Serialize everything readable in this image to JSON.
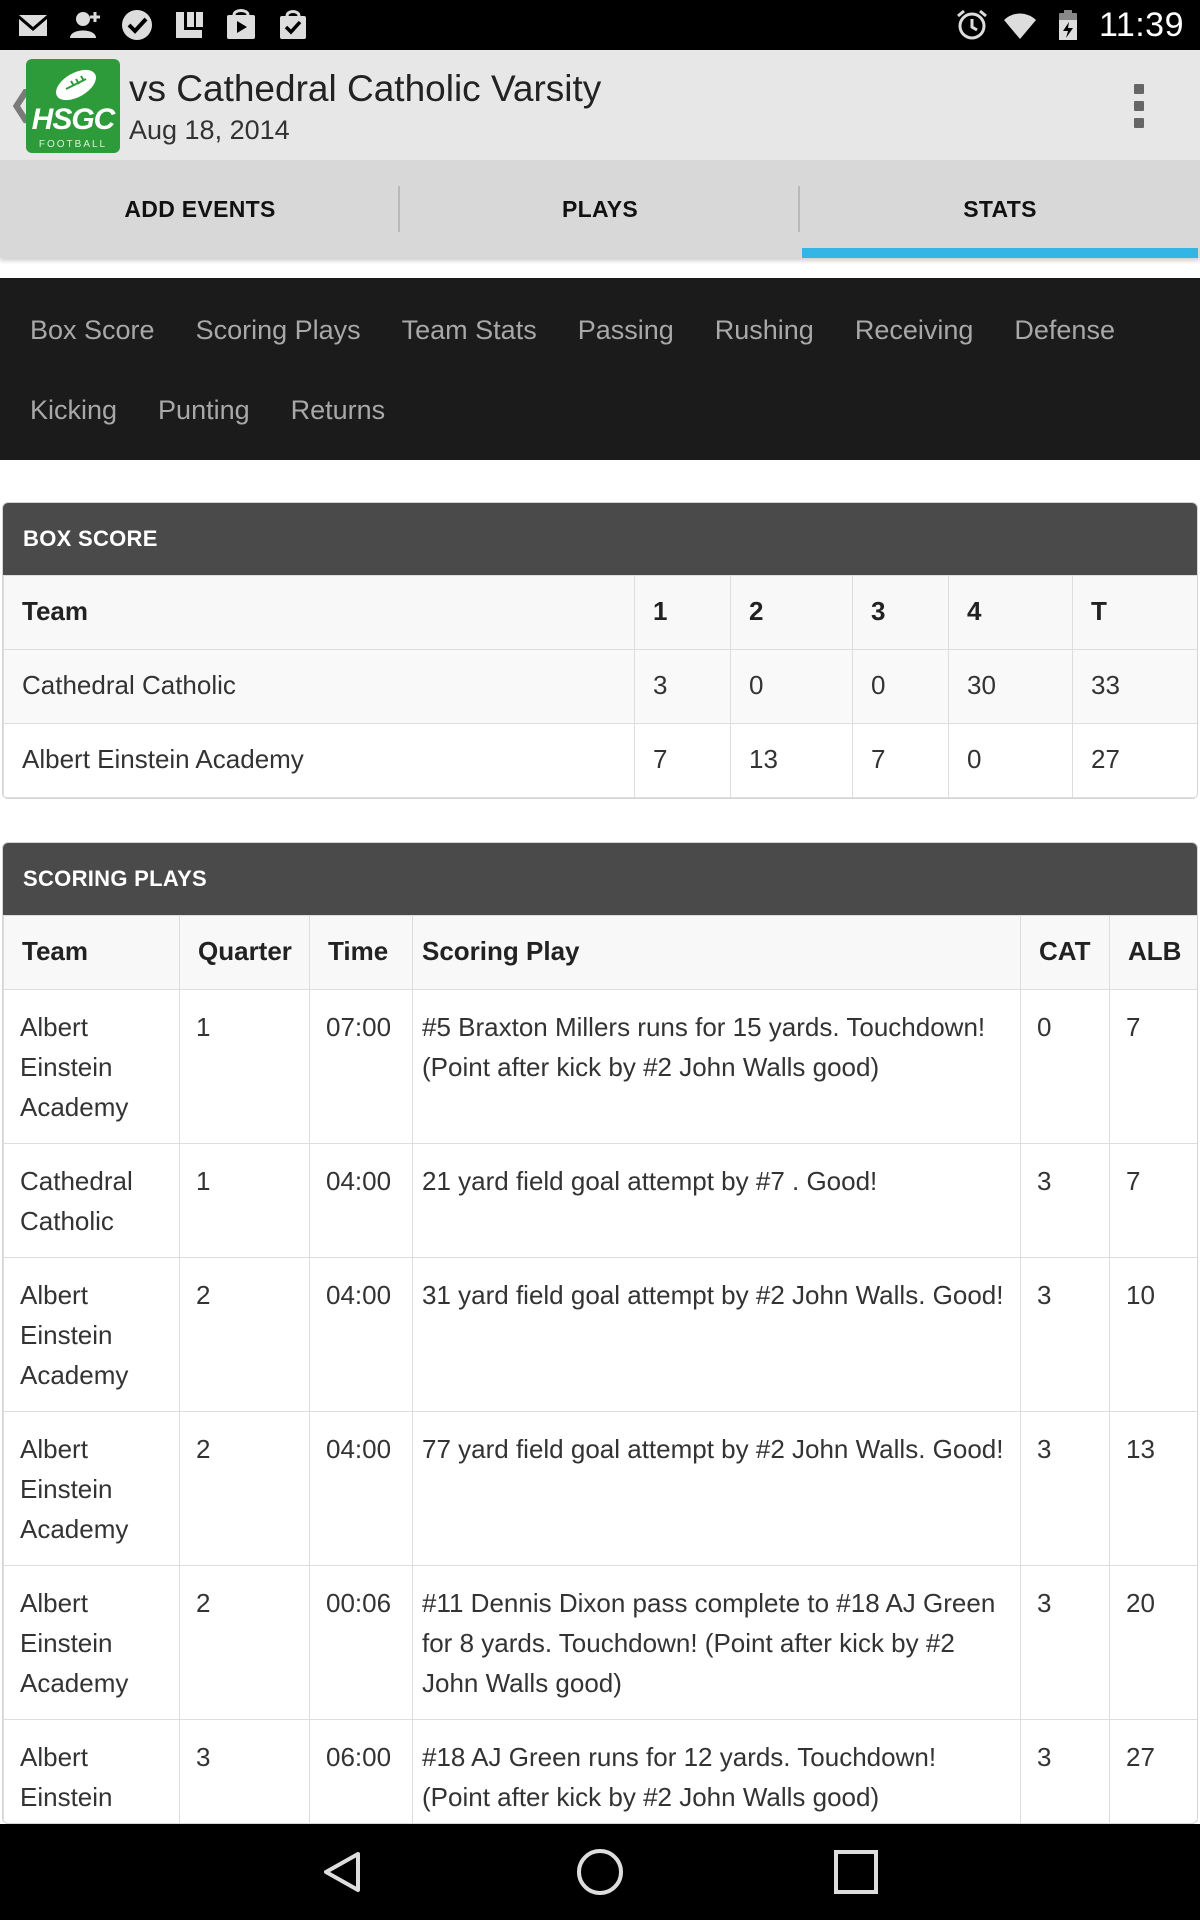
{
  "status_bar": {
    "left_icons": [
      "gmail-icon",
      "add-contact-icon",
      "task-done-icon",
      "app-icon",
      "play-store-icon",
      "shopping-bag-icon"
    ],
    "right_icons": [
      "alarm-icon",
      "wifi-icon",
      "battery-icon"
    ],
    "time": "11:39"
  },
  "header": {
    "logo_text": "HSGC",
    "logo_sub": "FOOTBALL",
    "title": "vs Cathedral Catholic Varsity",
    "date": "Aug 18, 2014"
  },
  "tabs": [
    {
      "label": "ADD EVENTS",
      "active": false
    },
    {
      "label": "PLAYS",
      "active": false
    },
    {
      "label": "STATS",
      "active": true
    }
  ],
  "stats_nav": [
    "Box Score",
    "Scoring Plays",
    "Team Stats",
    "Passing",
    "Rushing",
    "Receiving",
    "Defense",
    "Kicking",
    "Punting",
    "Returns"
  ],
  "box_score": {
    "heading": "BOX SCORE",
    "columns": [
      "Team",
      "1",
      "2",
      "3",
      "4",
      "T"
    ],
    "rows": [
      [
        "Cathedral Catholic",
        "3",
        "0",
        "0",
        "30",
        "33"
      ],
      [
        "Albert Einstein Academy",
        "7",
        "13",
        "7",
        "0",
        "27"
      ]
    ]
  },
  "scoring_plays": {
    "heading": "SCORING PLAYS",
    "columns": [
      "Team",
      "Quarter",
      "Time",
      "Scoring Play",
      "CAT",
      "ALB"
    ],
    "rows": [
      [
        "Albert Einstein Academy",
        "1",
        "07:00",
        "#5 Braxton Millers runs for 15 yards. Touchdown! (Point after kick by #2 John Walls good)",
        "0",
        "7"
      ],
      [
        "Cathedral Catholic",
        "1",
        "04:00",
        "21 yard field goal attempt by #7 . Good!",
        "3",
        "7"
      ],
      [
        "Albert Einstein Academy",
        "2",
        "04:00",
        "31 yard field goal attempt by #2 John Walls. Good!",
        "3",
        "10"
      ],
      [
        "Albert Einstein Academy",
        "2",
        "04:00",
        "77 yard field goal attempt by #2 John Walls. Good!",
        "3",
        "13"
      ],
      [
        "Albert Einstein Academy",
        "2",
        "00:06",
        "#11 Dennis Dixon pass complete to #18 AJ Green for 8 yards. Touchdown! (Point after kick by #2 John Walls good)",
        "3",
        "20"
      ],
      [
        "Albert Einstein Academy",
        "3",
        "06:00",
        "#18 AJ Green runs for 12 yards. Touchdown! (Point after kick by #2 John Walls good)",
        "3",
        "27"
      ]
    ]
  },
  "nav_bar": [
    "back-icon",
    "home-icon",
    "recents-icon"
  ],
  "colors": {
    "accent": "#33b5e5",
    "logo_green": "#2e9b3a",
    "panel_header": "#4a4a4a",
    "stats_nav_bg": "#1b1b1b"
  }
}
